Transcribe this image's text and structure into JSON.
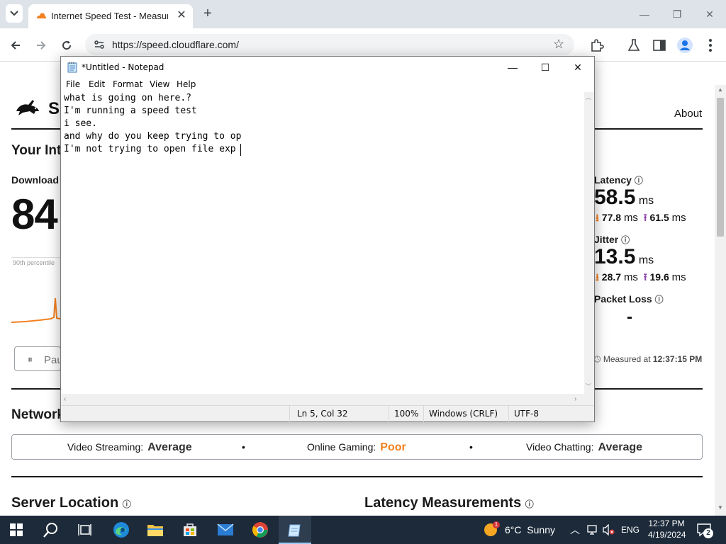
{
  "browser": {
    "tab_title": "Internet Speed Test - Measure",
    "tab_close": "✕",
    "new_tab": "+",
    "url": "https://speed.cloudflare.com/",
    "window_controls": {
      "minimize": "—",
      "restore": "❐",
      "close": "✕"
    }
  },
  "page": {
    "logo_letter": "S",
    "nav_about": "About",
    "heading_partial": "Your Int",
    "download_label": "Download",
    "download_value_partial": "84",
    "percentile_partial": "90th percentile",
    "pause_partial": "Pau",
    "latency": {
      "label": "Latency",
      "value": "58.5",
      "unit": "ms",
      "down": "77.8",
      "up": "61.5",
      "sub_unit": "ms"
    },
    "jitter": {
      "label": "Jitter",
      "value": "13.5",
      "unit": "ms",
      "down": "28.7",
      "up": "19.6",
      "sub_unit": "ms"
    },
    "packet_loss": {
      "label": "Packet Loss",
      "value": "-"
    },
    "measured_label": "Measured at",
    "measured_time": "12:37:15 PM",
    "network_heading_partial": "Network",
    "quality": [
      {
        "label": "Video Streaming:",
        "value": "Average",
        "color": "#333333"
      },
      {
        "label": "Online Gaming:",
        "value": "Poor",
        "color": "#f38020"
      },
      {
        "label": "Video Chatting:",
        "value": "Average",
        "color": "#333333"
      }
    ],
    "quality_separator": "•",
    "server_location": "Server Location",
    "latency_measurements": "Latency Measurements",
    "info_icon": "ⓘ",
    "accent_orange": "#f38020",
    "accent_purple": "#8e44ad"
  },
  "notepad": {
    "title": "*Untitled - Notepad",
    "menu": [
      "File",
      "Edit",
      "Format",
      "View",
      "Help"
    ],
    "lines": [
      "what is going on here.?",
      "I'm running a speed test",
      "i see.",
      "and why do you keep trying to op",
      "I'm not trying to open file exp"
    ],
    "status": {
      "position": "Ln 5, Col 32",
      "zoom": "100%",
      "line_ending": "Windows (CRLF)",
      "encoding": "UTF-8"
    }
  },
  "taskbar": {
    "weather_temp": "6°C",
    "weather_text": "Sunny",
    "weather_badge": "1",
    "language": "ENG",
    "time": "12:37 PM",
    "date": "4/19/2024",
    "notification_count": "2"
  }
}
